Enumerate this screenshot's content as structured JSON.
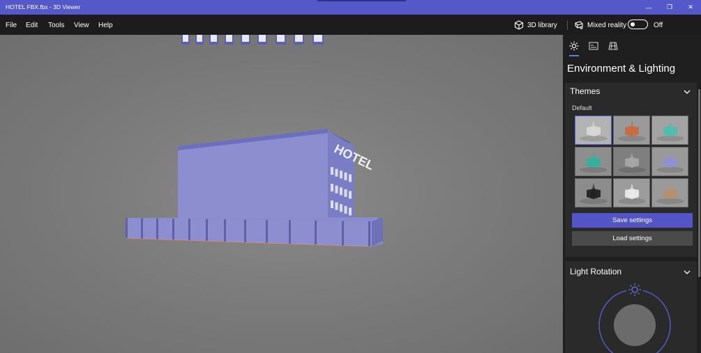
{
  "window": {
    "title": "HOTEL FBX.fbx - 3D Viewer",
    "minimize": "—",
    "restore": "❐",
    "close": "✕"
  },
  "menu": [
    "File",
    "Edit",
    "Tools",
    "View",
    "Help"
  ],
  "toolbar": {
    "library_label": "3D library",
    "mixed_reality_label": "Mixed reality",
    "mixed_reality_state": "Off"
  },
  "model": {
    "sign_text": "HOTEL"
  },
  "panel": {
    "title": "Environment & Lighting",
    "themes_label": "Themes",
    "default_label": "Default",
    "save_label": "Save settings",
    "load_label": "Load settings",
    "light_rotation_label": "Light Rotation"
  },
  "themes": [
    {
      "bg": "#b3b3b3",
      "accent": "#d9d9d9",
      "selected": true
    },
    {
      "bg": "#9a9a9a",
      "accent": "#c76a3e",
      "selected": false
    },
    {
      "bg": "#a3a3a3",
      "accent": "#4bbfae",
      "selected": false
    },
    {
      "bg": "#8e8e8e",
      "accent": "#2fb39b",
      "selected": false
    },
    {
      "bg": "#7f7f7f",
      "accent": "#a9a9a9",
      "selected": false
    },
    {
      "bg": "#999999",
      "accent": "#8f8fd8",
      "selected": false
    },
    {
      "bg": "#8c8c8c",
      "accent": "#1e1e1e",
      "selected": false
    },
    {
      "bg": "#9c9c9c",
      "accent": "#eeeeee",
      "selected": false
    },
    {
      "bg": "#9a9a9a",
      "accent": "#b88f6c",
      "selected": false
    }
  ],
  "colors": {
    "accent": "#5558c9",
    "building": "#8d8ed0",
    "window_frame": "#e8e8f0"
  }
}
